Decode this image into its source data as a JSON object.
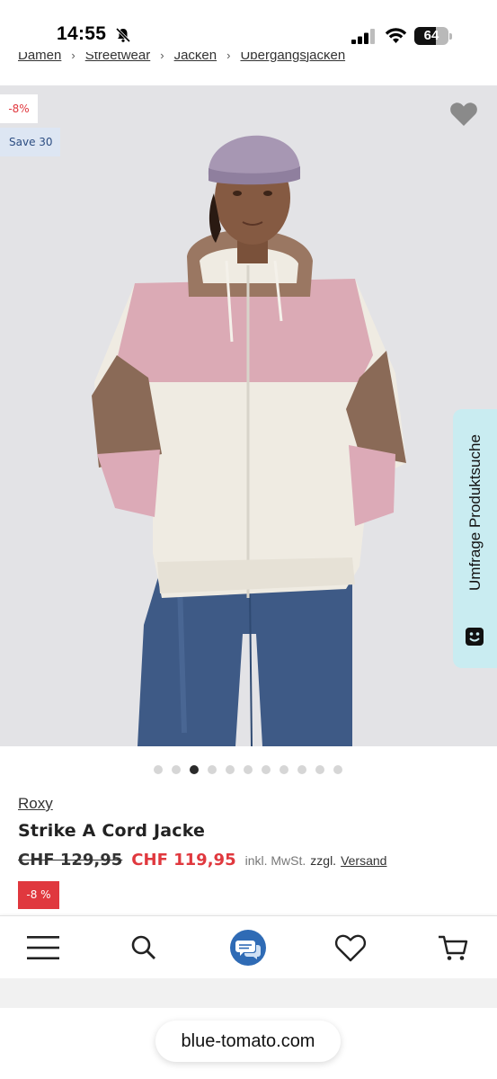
{
  "status_bar": {
    "time": "14:55",
    "battery_level": "64",
    "icons": [
      "bell-off-icon",
      "signal-icon",
      "wifi-icon",
      "battery-icon"
    ]
  },
  "breadcrumb": [
    "Damen",
    "Streetwear",
    "Jacken",
    "Übergangsjacken"
  ],
  "gallery": {
    "badge_discount": "-8%",
    "badge_save": "Save 30",
    "total_images": 11,
    "active_index": 2,
    "image_description_icon": "wishlist-heart-icon"
  },
  "survey_tab": {
    "label": "Umfrage Produktsuche"
  },
  "product": {
    "brand": "Roxy",
    "title": "Strike A Cord Jacke",
    "price_old": "CHF 129,95",
    "price_new": "CHF 119,95",
    "tax_note": "inkl. MwSt.",
    "tax_extra": "zzgl.",
    "shipping_link": "Versand",
    "discount_badge": "-8 %"
  },
  "bottom_nav": {
    "items": [
      "menu-icon",
      "search-icon",
      "chat-icon",
      "wishlist-icon",
      "cart-icon"
    ]
  },
  "url_bar": {
    "domain": "blue-tomato.com"
  },
  "colors": {
    "sale_red": "#e0383e",
    "save_blue_bg": "#dde6f3",
    "survey_cyan": "#c9ecf1",
    "chat_blue": "#2f6bb5"
  }
}
